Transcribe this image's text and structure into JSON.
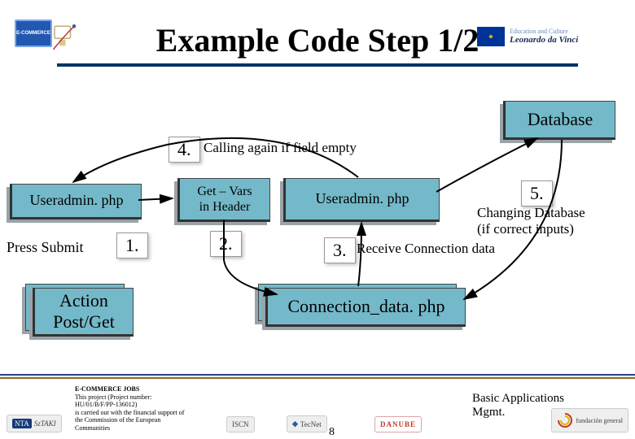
{
  "header": {
    "title": "Example Code  Step 1/2",
    "eu_line1": "Education and Culture",
    "eu_line2": "Leonardo da Vinci"
  },
  "steps": {
    "s1": "1.",
    "s2": "2.",
    "s3": "3.",
    "s4": "4.",
    "s5": "5."
  },
  "labels": {
    "database": "Database",
    "calling": "Calling again if field empty",
    "getvars": "Get – Vars\nin Header",
    "useradmin1": "Useradmin. php",
    "useradmin2": "Useradmin. php",
    "press_submit": "Press Submit",
    "receive": "Receive Connection data",
    "changing": "Changing Database\n(if correct inputs)",
    "action": "Action\nPost/Get",
    "conn_data": "Connection_data. php"
  },
  "footer": {
    "proj1": "E-COMMERCE JOBS",
    "proj2": "This project (Project number:",
    "proj3": "HU/01/B/F/PP-136012)",
    "proj4": "is carried out with the financial support of",
    "proj5": "the Commission of the European",
    "proj6": "Communities",
    "basic": "Basic Applications\nMgmt.",
    "pagenum": "8",
    "iscn": "ISCN",
    "tecnet": "TecNet",
    "danube": "DANUBE"
  },
  "ecom_label": "E-COMMERCE"
}
